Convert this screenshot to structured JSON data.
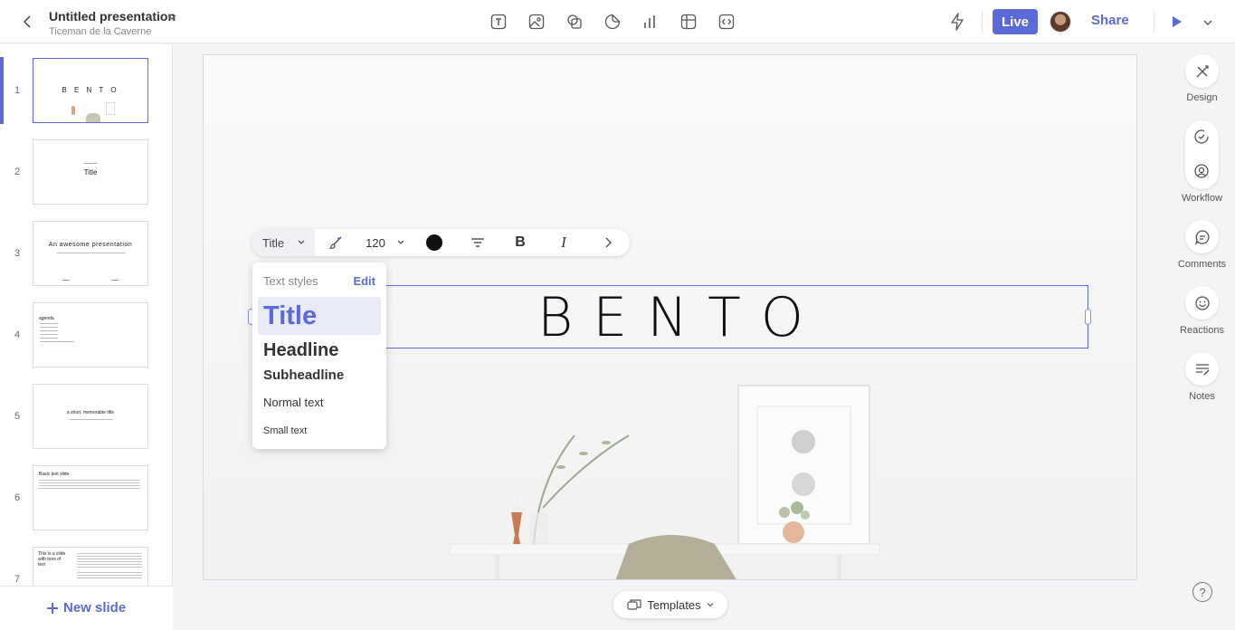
{
  "header": {
    "title": "Untitled presentation",
    "owner": "Ticeman de la Caverne",
    "live_label": "Live",
    "share_label": "Share",
    "insert_tools": [
      "text-icon",
      "image-icon",
      "shapes-icon",
      "sticker-icon",
      "chart-icon",
      "table-icon",
      "embed-icon"
    ]
  },
  "slides": [
    {
      "num": "1",
      "thumb_text": "B E N T O"
    },
    {
      "num": "2",
      "thumb_text": "Title"
    },
    {
      "num": "3",
      "thumb_text": "An awesome presentation"
    },
    {
      "num": "4",
      "thumb_text": "agenda"
    },
    {
      "num": "5",
      "thumb_text": "a short, memorable title"
    },
    {
      "num": "6",
      "thumb_text": "Basic text slide"
    },
    {
      "num": "7",
      "thumb_text": "This is a slide with tons of text"
    }
  ],
  "new_slide_label": "New slide",
  "canvas": {
    "title_text": "BENTO"
  },
  "format_toolbar": {
    "style": "Title",
    "font_size": "120",
    "bold": "B",
    "italic": "I"
  },
  "text_styles_menu": {
    "header": "Text styles",
    "edit": "Edit",
    "options": [
      "Title",
      "Headline",
      "Subheadline",
      "Normal text",
      "Small text"
    ]
  },
  "right_panel": {
    "design": "Design",
    "workflow": "Workflow",
    "comments": "Comments",
    "reactions": "Reactions",
    "notes": "Notes"
  },
  "templates_label": "Templates",
  "help_label": "?"
}
